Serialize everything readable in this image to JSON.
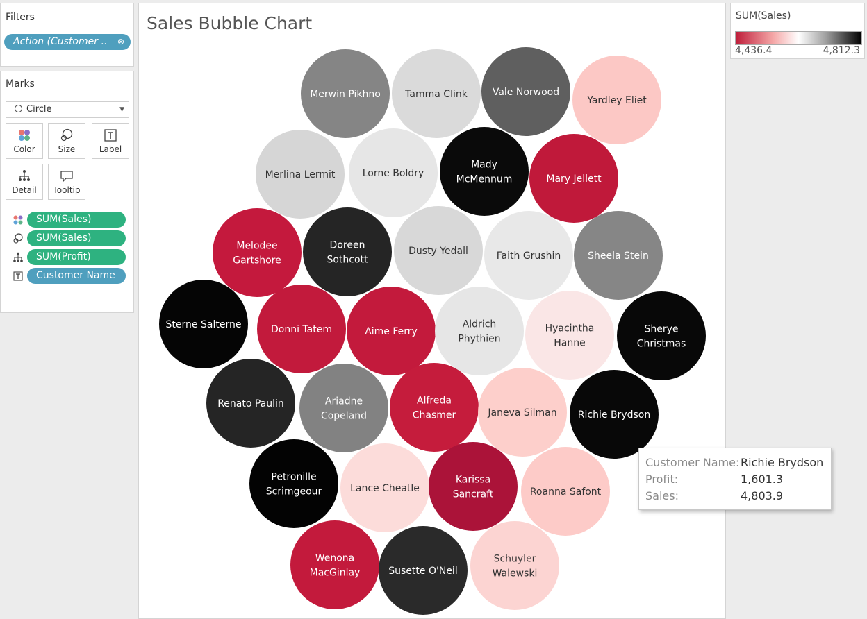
{
  "filters": {
    "title": "Filters",
    "pill_label": "Action (Customer ..",
    "pill_icon": "link-icon"
  },
  "marks": {
    "title": "Marks",
    "mark_type": "Circle",
    "buttons": [
      {
        "label": "Color",
        "icon": "color-icon"
      },
      {
        "label": "Size",
        "icon": "size-icon"
      },
      {
        "label": "Label",
        "icon": "label-icon"
      },
      {
        "label": "Detail",
        "icon": "detail-icon"
      },
      {
        "label": "Tooltip",
        "icon": "tooltip-icon"
      }
    ],
    "shelf": [
      {
        "icon": "color-icon",
        "field": "SUM(Sales)",
        "color": "#2eb280"
      },
      {
        "icon": "size-icon",
        "field": "SUM(Sales)",
        "color": "#2eb280"
      },
      {
        "icon": "detail-icon",
        "field": "SUM(Profit)",
        "color": "#2eb280"
      },
      {
        "icon": "label-icon",
        "field": "Customer Name",
        "color": "#4f9fbe"
      }
    ]
  },
  "legend": {
    "title": "SUM(Sales)",
    "min": "4,436.4",
    "max": "4,812.3"
  },
  "tooltip": {
    "rows": [
      {
        "key": "Customer Name:",
        "value": "Richie Brydson"
      },
      {
        "key": "Profit:",
        "value": "1,601.3"
      },
      {
        "key": "Sales:",
        "value": "4,803.9"
      }
    ]
  },
  "chart_data": {
    "type": "bubble",
    "title": "Sales Bubble Chart",
    "color_field": "SUM(Sales)",
    "color_range": [
      4436.4,
      4812.3
    ],
    "bubbles": [
      {
        "label": [
          "Merwin Pikhno"
        ],
        "color": "#858585"
      },
      {
        "label": [
          "Tamma Clink"
        ],
        "color": "#dadada"
      },
      {
        "label": [
          "Vale Norwood"
        ],
        "color": "#5f5f5f"
      },
      {
        "label": [
          "Yardley Eliet"
        ],
        "color": "#fcc8c5"
      },
      {
        "label": [
          "Merlina Lermit"
        ],
        "color": "#d6d6d6"
      },
      {
        "label": [
          "Lorne Boldry"
        ],
        "color": "#e6e6e6"
      },
      {
        "label": [
          "Mady",
          "McMennum"
        ],
        "color": "#0a0a0a"
      },
      {
        "label": [
          "Mary Jellett"
        ],
        "color": "#c0193a"
      },
      {
        "label": [
          "Melodee",
          "Gartshore"
        ],
        "color": "#c4193d"
      },
      {
        "label": [
          "Doreen",
          "Sothcott"
        ],
        "color": "#252525"
      },
      {
        "label": [
          "Dusty Yedall"
        ],
        "color": "#d8d8d8"
      },
      {
        "label": [
          "Faith Grushin"
        ],
        "color": "#e8e8e8"
      },
      {
        "label": [
          "Sheela Stein"
        ],
        "color": "#868686"
      },
      {
        "label": [
          "Sterne Salterne"
        ],
        "color": "#050505"
      },
      {
        "label": [
          "Donni Tatem"
        ],
        "color": "#c21a3c"
      },
      {
        "label": [
          "Aime Ferry"
        ],
        "color": "#c31a3c"
      },
      {
        "label": [
          "Aldrich",
          "Phythien"
        ],
        "color": "#e6e6e6"
      },
      {
        "label": [
          "Hyacintha",
          "Hanne"
        ],
        "color": "#fae6e6"
      },
      {
        "label": [
          "Sherye",
          "Christmas"
        ],
        "color": "#080808"
      },
      {
        "label": [
          "Renato Paulin"
        ],
        "color": "#252525"
      },
      {
        "label": [
          "Ariadne",
          "Copeland"
        ],
        "color": "#828282"
      },
      {
        "label": [
          "Alfreda",
          "Chasmer"
        ],
        "color": "#c51c3c"
      },
      {
        "label": [
          "Janeva Silman"
        ],
        "color": "#fdcfcb"
      },
      {
        "label": [
          "Richie Brydson"
        ],
        "color": "#080808"
      },
      {
        "label": [
          "Petronille",
          "Scrimgeour"
        ],
        "color": "#030303"
      },
      {
        "label": [
          "Lance Cheatle"
        ],
        "color": "#fcdcda"
      },
      {
        "label": [
          "Karissa",
          "Sancraft"
        ],
        "color": "#ab1339"
      },
      {
        "label": [
          "Roanna Safont"
        ],
        "color": "#fdcbc8"
      },
      {
        "label": [
          "Wenona",
          "MacGinlay"
        ],
        "color": "#c31a3c"
      },
      {
        "label": [
          "Susette O'Neil"
        ],
        "color": "#2a2a2a"
      },
      {
        "label": [
          "Schuyler",
          "Walewski"
        ],
        "color": "#fcd4d2"
      }
    ]
  }
}
